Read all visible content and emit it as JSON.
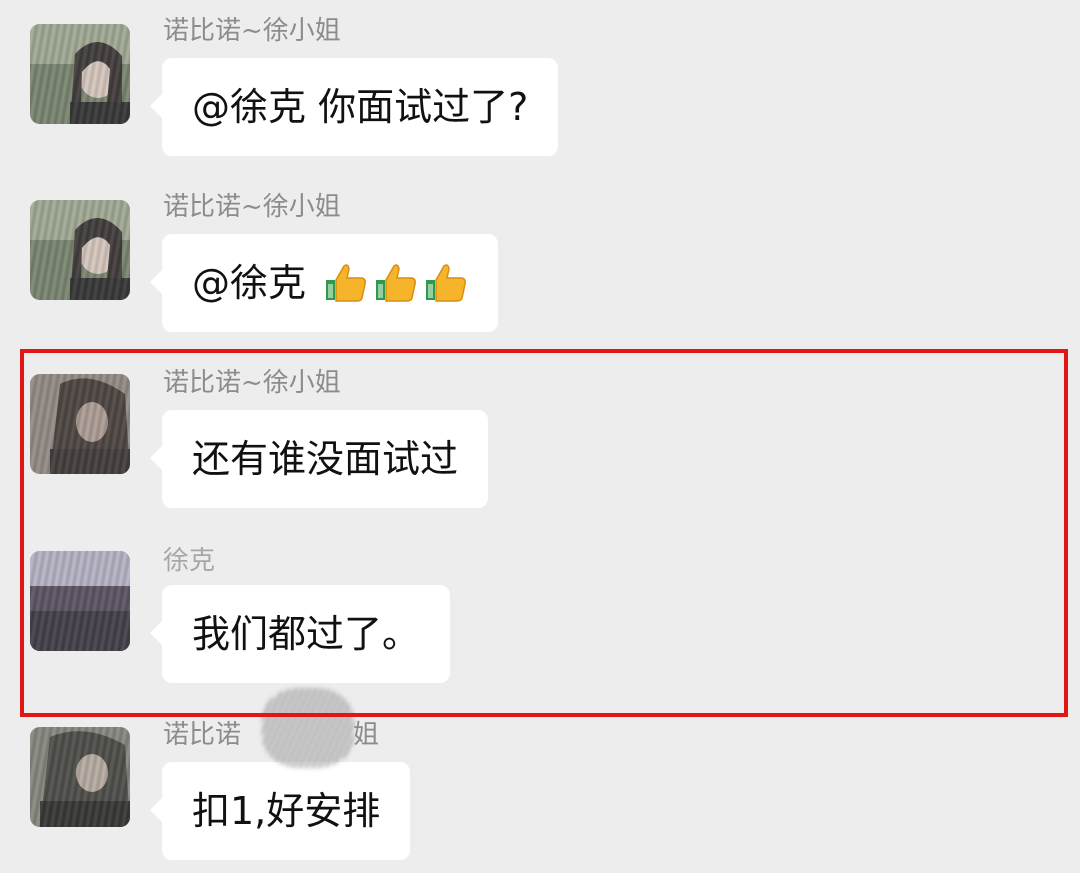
{
  "messages": [
    {
      "sender": "诺比诺~徐小姐",
      "text": "@徐克 你面试过了?",
      "avatar": "avatar-woman-photo"
    },
    {
      "sender": "诺比诺~徐小姐",
      "text": "@徐克",
      "emoji": [
        "thumbs-up-icon",
        "thumbs-up-icon",
        "thumbs-up-icon"
      ],
      "avatar": "avatar-woman-photo"
    },
    {
      "sender": "诺比诺~徐小姐",
      "text": "还有谁没面试过",
      "avatar": "avatar-woman-photo-scribbled"
    },
    {
      "sender": "徐克",
      "text": "我们都过了。",
      "avatar": "avatar-scribbled"
    },
    {
      "sender": "诺比诺",
      "sender_tail": "姐",
      "text": "扣1,好安排",
      "avatar": "avatar-woman-photo-scribbled"
    }
  ],
  "highlight_color": "#e21616",
  "bubble_color": "#ffffff",
  "background_color": "#ededed"
}
